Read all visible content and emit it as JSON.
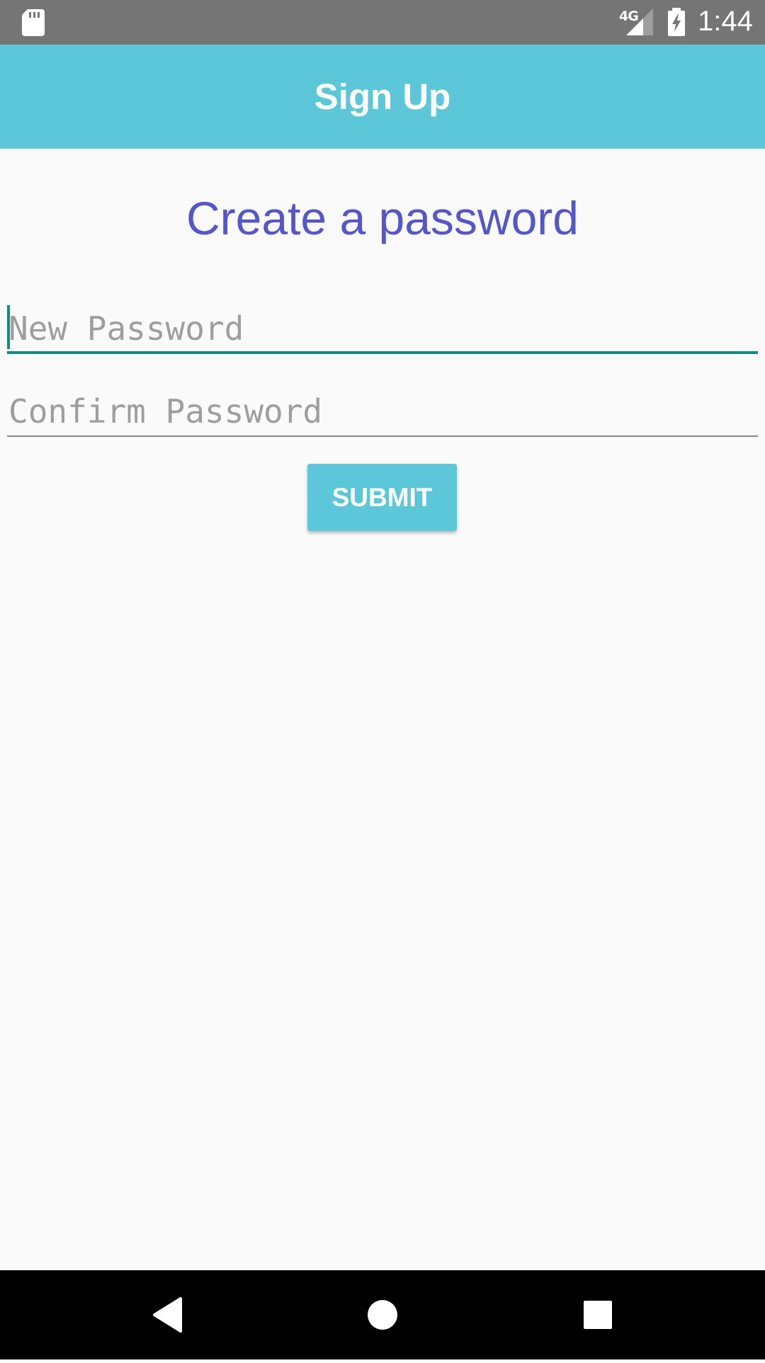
{
  "status_bar": {
    "network_type": "4G",
    "time": "1:44",
    "icons": [
      "sd-card-icon",
      "cell-signal-icon",
      "battery-charging-icon"
    ]
  },
  "app_bar": {
    "title": "Sign Up"
  },
  "main": {
    "heading": "Create a password",
    "new_password": {
      "placeholder": "New Password",
      "value": ""
    },
    "confirm_password": {
      "placeholder": "Confirm Password",
      "value": ""
    },
    "submit_label": "SUBMIT"
  },
  "nav_bar": {
    "icons": [
      "back-icon",
      "home-icon",
      "recents-icon"
    ]
  },
  "colors": {
    "status_bar": "#757575",
    "app_bar": "#5bc7d8",
    "heading": "#5656cc",
    "accent": "#128c7e",
    "background": "#fafafa"
  }
}
